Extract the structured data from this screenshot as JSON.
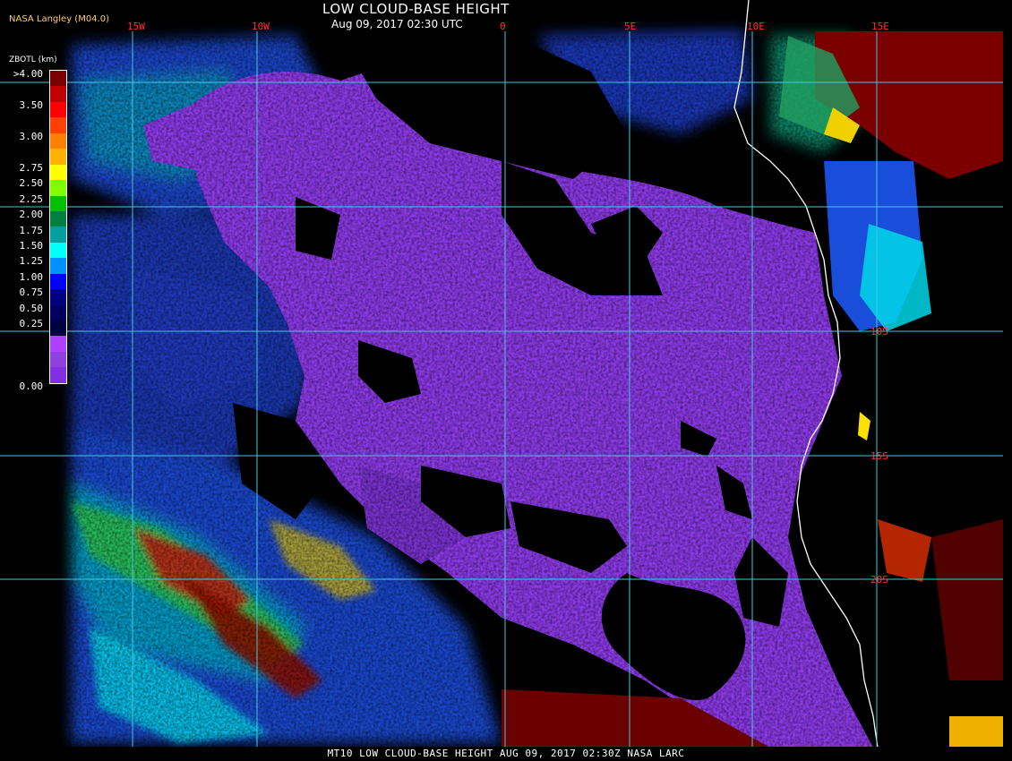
{
  "header": {
    "title": "LOW CLOUD-BASE HEIGHT",
    "subtitle": "Aug 09, 2017 02:30 UTC",
    "org": "NASA Langley (M04.0)"
  },
  "legend": {
    "title": "ZBOTL (km)",
    "top_label": ">4.00",
    "labels": [
      "3.50",
      "3.00",
      "2.75",
      "2.50",
      "2.25",
      "2.00",
      "1.75",
      "1.50",
      "1.25",
      "1.00",
      "0.75",
      "0.50",
      "0.25",
      "0.00"
    ],
    "colors": [
      "#7a0000",
      "#c00000",
      "#ff0000",
      "#ff4000",
      "#ff8000",
      "#ffb000",
      "#ffff00",
      "#80ff00",
      "#00c000",
      "#008040",
      "#00a0a0",
      "#00ffff",
      "#0090ff",
      "#0000ff",
      "#000080",
      "#000060",
      "#000040",
      "#b040ff",
      "#9040e0",
      "#8030e0"
    ],
    "label_slots": [
      0,
      2,
      4,
      6,
      7,
      8,
      9,
      10,
      11,
      12,
      13,
      14,
      15,
      16,
      19
    ]
  },
  "grid": {
    "color": "#40c8e0",
    "longitudes": [
      "15W",
      "10W",
      "0",
      "5E",
      "10E",
      "15E"
    ],
    "latitudes": [
      "10S",
      "15S",
      "20S"
    ]
  },
  "map_colors": {
    "background": "#000000",
    "low_cloud": "#8d3ae8",
    "dark_blue": "#1f2ab8",
    "blue": "#1c5cff",
    "cyan": "#00d8e8",
    "teal": "#0a9a8a",
    "green": "#30c040",
    "yellow": "#f0d000",
    "red": "#e02000",
    "dark_red": "#7a0000",
    "coast": "#ffffff"
  },
  "footer": {
    "text": "MT10  LOW CLOUD-BASE HEIGHT   AUG 09, 2017 02:30Z   NASA LARC"
  }
}
